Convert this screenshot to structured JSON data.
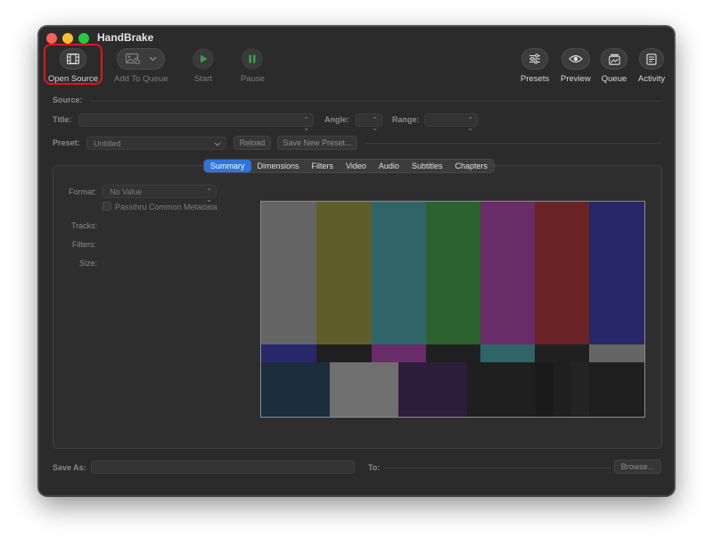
{
  "app_title": "HandBrake",
  "toolbar": {
    "open_source": "Open Source",
    "add_to_queue": "Add To Queue",
    "start": "Start",
    "pause": "Pause",
    "presets": "Presets",
    "preview": "Preview",
    "queue": "Queue",
    "activity": "Activity"
  },
  "source_label": "Source:",
  "title_label": "Title:",
  "angle_label": "Angle:",
  "range_label": "Range:",
  "preset_label": "Preset:",
  "preset_value": "Untitled",
  "reload_button": "Reload",
  "save_preset_button": "Save New Preset...",
  "tabs": [
    "Summary",
    "Dimensions",
    "Filters",
    "Video",
    "Audio",
    "Subtitles",
    "Chapters"
  ],
  "summary": {
    "format_label": "Format:",
    "format_value": "No Value",
    "passthru_label": "Passthru Common Metadata",
    "tracks_label": "Tracks:",
    "filters_label": "Filters:",
    "size_label": "Size:"
  },
  "save_as_label": "Save As:",
  "to_label": "To:",
  "browse_button": "Browse...",
  "colors": {
    "accent": "#2f74dc",
    "highlight": "#e0161b"
  },
  "icons": [
    "film-icon",
    "picture-icon",
    "chevron-down-icon",
    "play-icon",
    "pause-icon",
    "sliders-icon",
    "eye-icon",
    "queue-icon",
    "activity-icon"
  ]
}
